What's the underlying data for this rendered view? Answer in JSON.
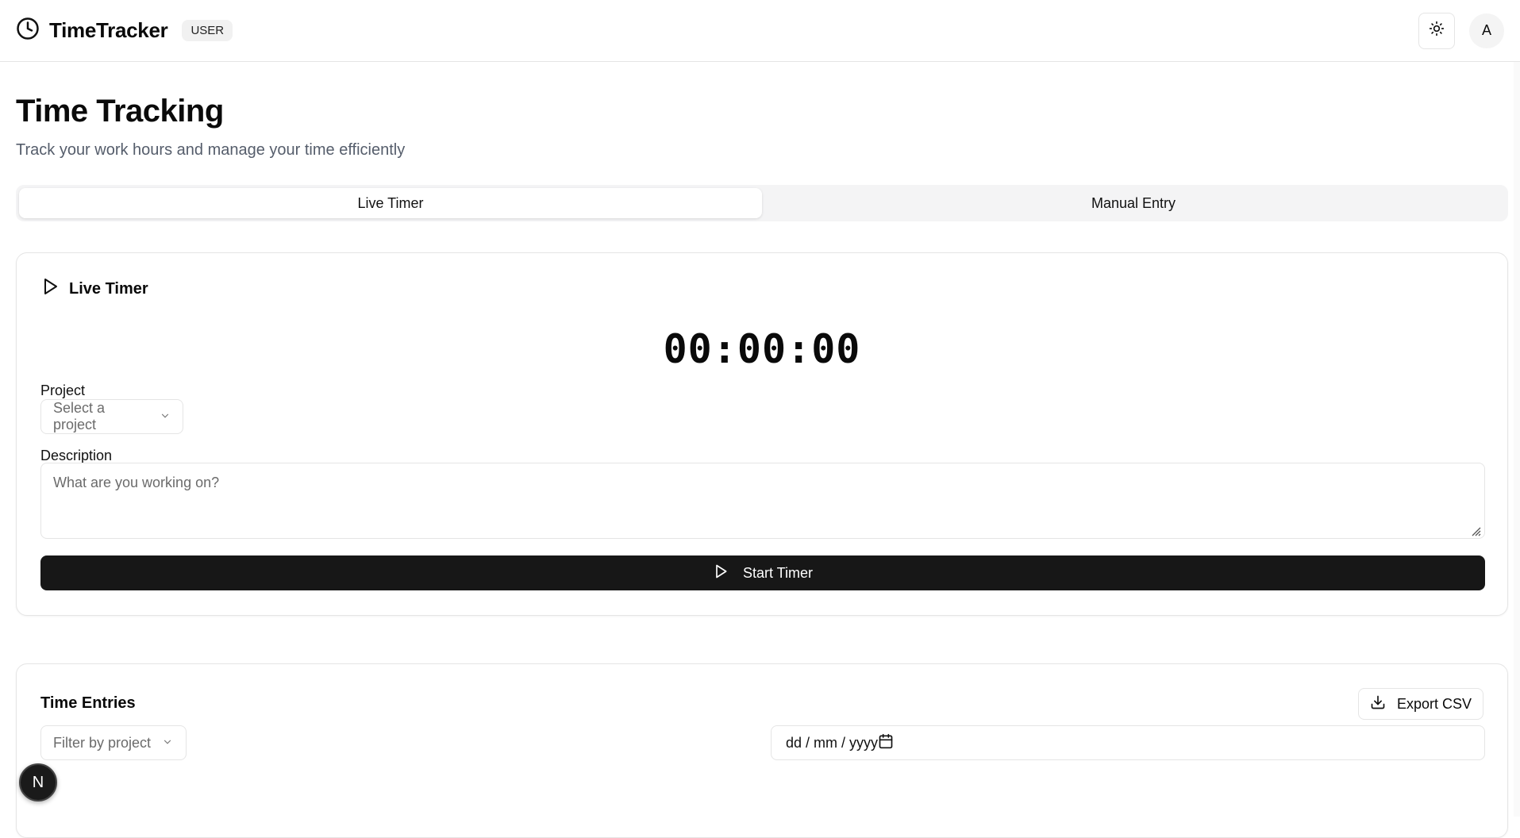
{
  "app": {
    "name": "TimeTracker",
    "role_badge": "USER",
    "avatar_initial": "A"
  },
  "page": {
    "title": "Time Tracking",
    "subtitle": "Track your work hours and manage your time efficiently"
  },
  "tabs": [
    {
      "label": "Live Timer",
      "active": true
    },
    {
      "label": "Manual Entry",
      "active": false
    }
  ],
  "live_timer": {
    "title": "Live Timer",
    "display": "00:00:00",
    "project_label": "Project",
    "project_placeholder": "Select a project",
    "description_label": "Description",
    "description_placeholder": "What are you working on?",
    "start_label": "Start Timer"
  },
  "time_entries": {
    "title": "Time Entries",
    "export_label": "Export CSV",
    "filter_placeholder": "Filter by project",
    "date_placeholder": "dd / mm / yyyy"
  },
  "dev_badge": "N",
  "icons": {
    "brand": "clock-icon",
    "theme": "sun-icon",
    "timer": "play-icon",
    "select": "chevron-down-icon",
    "export": "download-icon",
    "date": "calendar-icon"
  },
  "colors": {
    "primary_button": "#171717",
    "tab_background": "#f4f4f5",
    "border": "#e5e5e5",
    "muted_text": "#555d6b"
  }
}
